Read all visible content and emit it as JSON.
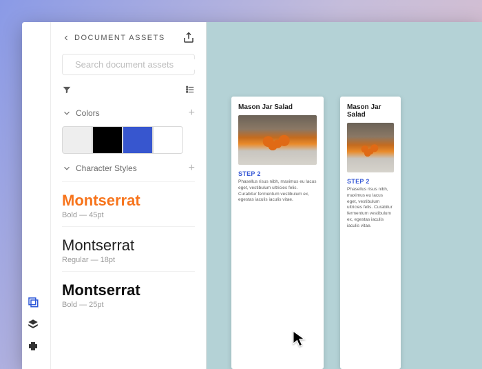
{
  "panel": {
    "title": "DOCUMENT ASSETS",
    "search_placeholder": "Search document assets",
    "sections": {
      "colors": {
        "label": "Colors",
        "swatches": [
          "#eeeeee",
          "#000000",
          "#3756cf",
          "#ffffff"
        ]
      },
      "char_styles": {
        "label": "Character Styles",
        "items": [
          {
            "preview": "Montserrat",
            "meta": "Bold — 45pt",
            "variant": "bold-orange"
          },
          {
            "preview": "Montserrat",
            "meta": "Regular — 18pt",
            "variant": "regular"
          },
          {
            "preview": "Montserrat",
            "meta": "Bold — 25pt",
            "variant": "bold-black"
          }
        ]
      }
    }
  },
  "canvas": {
    "cards": [
      {
        "title": "Mason Jar Salad",
        "step": "STEP 2",
        "body": "Phasellus risus nibh, maximus eu lacus eget, vestibulum ultricies felis. Curabitur fermentum vestibulum ex, egestas iaculis iaculis vitae."
      },
      {
        "title": "Mason Jar Salad",
        "step": "STEP 2",
        "body": "Phasellus risus nibh, maximus eu lacus eget, vestibulum ultricies felis. Curabitur fermentum vestibulum ex, egestas iaculis iaculis vitae."
      }
    ]
  },
  "icons": {
    "back": "chevron-left",
    "share": "share",
    "search": "search",
    "collapse": "chevron-down",
    "filter": "funnel",
    "list": "list",
    "plus": "+"
  },
  "colors": {
    "accent": "#3756cf",
    "orange": "#f7741c",
    "canvas_bg": "#b4d2d6"
  }
}
